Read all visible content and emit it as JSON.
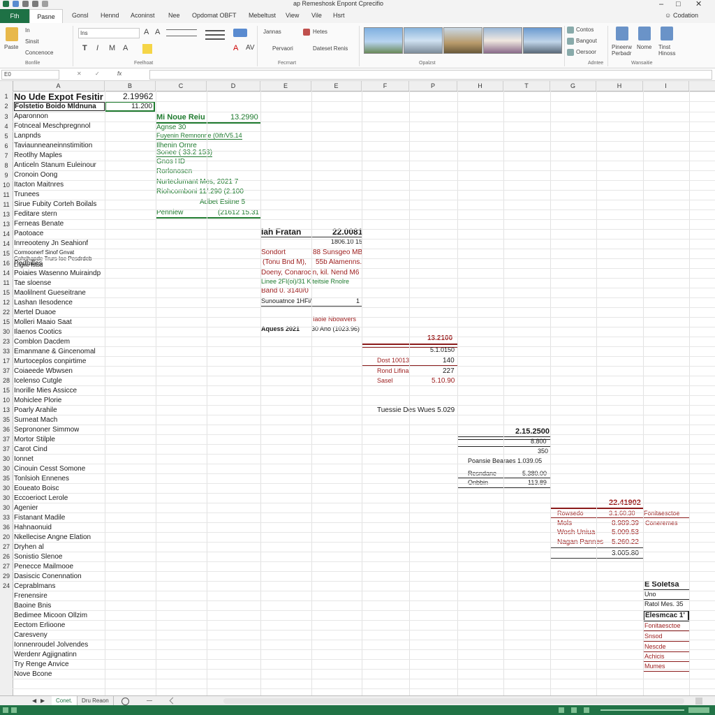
{
  "titlebar": {
    "title": "ap Remeshosk Enpont Cprecifio",
    "min": "–",
    "max": "□",
    "close": "✕"
  },
  "menu": {
    "file": "Fth",
    "home": "Pasne",
    "items": [
      "Gonsl",
      "Hennd",
      "Aconinst",
      "Nee",
      "Opdomat OBFT",
      "Mebeltust",
      "View",
      "Vile",
      "Hsrt"
    ],
    "help": "Codation",
    "user": "☺"
  },
  "ribbon": {
    "clipboard": {
      "paste": "Paste",
      "cut": "In",
      "copy": "Sinsit",
      "format": "Concenoce",
      "name": "Bonfile"
    },
    "font": {
      "name": "Feelhoat",
      "font_value": "Ins",
      "bold": "T",
      "italic": "I",
      "underline": "M",
      "grow": "A",
      "size": "A",
      "fill": "A",
      "border": "AV"
    },
    "alignment": {
      "name": "Fecrnart",
      "items": [
        "Jannas",
        "Hetes",
        "Pervaori",
        "Dateset Renis"
      ]
    },
    "styles": {
      "name": "Opalzst"
    },
    "cells": {
      "name": "Adntee",
      "items": [
        "Contos",
        "Bangout",
        "Oersoor"
      ]
    },
    "editing": {
      "name": "Wansaitie",
      "items": [
        "Pineerw Perbadr",
        "Nome",
        "Tinst Hinoss"
      ]
    }
  },
  "formula_bar": {
    "name_box": "E0",
    "fx": "fx",
    "formula": ""
  },
  "columns": [
    "A",
    "B",
    "C",
    "D",
    "E",
    "E",
    "F",
    "P",
    "H",
    "T",
    "G",
    "H",
    "I"
  ],
  "rows": [
    "1",
    "2",
    "3",
    "4",
    "5",
    "6",
    "7",
    "8",
    "9",
    "10",
    "11",
    "11",
    "13",
    "13",
    "14",
    "14",
    "15",
    "16",
    "14",
    "11",
    "15",
    "12",
    "22",
    "15",
    "30",
    "23",
    "33",
    "17",
    "37",
    "28",
    "15",
    "10",
    "13",
    "35",
    "36",
    "37",
    "37",
    "30",
    "30",
    "35",
    "30",
    "30",
    "30",
    "33",
    "36",
    "20",
    "27",
    "26",
    "27",
    "29",
    "24"
  ],
  "col_a": [
    "No Ude Expot Fesitire",
    "Folstetio Boido Mldnuna",
    "Aparonnon",
    "Fotnceal Meschpregnnol",
    "Lanpnds",
    "Taviaunneaneinnstimition",
    "Reotlhy Maples",
    "Anticeln Stanum Euleinour",
    "Cronoin Oong",
    "Itacton Maitnres",
    "Trunees",
    "Sirue Fubity Corteh Boilals",
    "Feditare stern",
    "Ferneas Benate",
    "Paotoace",
    "Inrreooteny Jn Seahionf",
    "Cormoonerf Sinof Gnvat Cohrihapde Trurs Ioe Pesdrdeb Lngne Istsd",
    "Pedhilies",
    "Poiaies Wasenno Muiraindp",
    "Tae sloense",
    "Maolilnent Gueseitrane",
    "Lashan Ilesodence",
    "Mertel Duaoe",
    "Molleri Maaio Saat",
    "Ilaenos Cootics",
    "Comblon Dacdem",
    "Emanmane & Gincenomal",
    "Murtoceplos conpirtime",
    "Coiaeede Wbwsen",
    "Icelenso Cutgle",
    "Inorille Mies Assicce",
    "Mohiclee Plorie",
    "Poarly Arahile",
    "Surneat Mach",
    "Seprononer Simmow",
    "Mortor Stilple",
    "Carot Cind",
    "Ionnet",
    "Cinouin Cesst Somone",
    "Tonlsioh Ennenes",
    "Eoueato Boisc",
    "Eccoerioct Lerole",
    "Agenier",
    "Fistanant Madile",
    "Hahnaonuid",
    "Nkellecise Angne Elation",
    "Dryhen al",
    "Sonistio Slenoe",
    "Penecce Mailmooe",
    "Dasiscic Conennation",
    "Ceprablmans",
    "Frenensire",
    "Baoine Bnis",
    "Bedimee Micoon Ollzim",
    "Eectom Erlioone",
    "Caresveny",
    "Ionnenroudel Jolvendes",
    "Werdenr Agjignatinn",
    "Try Renge Anvice",
    "Nove Bcone"
  ],
  "block_b": {
    "b1": "2.19962",
    "b2": "11.200"
  },
  "block_c": {
    "title": "Mi Noue Reiu",
    "title_val": "13.2990",
    "lines": [
      "Agnse 30",
      "Fuyenin Remnonne (0ifr/V5.14",
      "Ilhenin Ornre",
      "Sonee ( 33.2 153)",
      "Gnos HD",
      "Rorlonosen",
      "Nurteclumant Mes, 2021 7",
      "Riohcomboni 11/.290 (2.100",
      "Adbet Esitne 5",
      "Penniew",
      "(21612 15.31"
    ]
  },
  "block_e": {
    "title": "Iah Fratan",
    "title_val": "22.0081",
    "sub": "1806.10 15",
    "l1a": "Sondort",
    "l1b": "88 Sunsgeo MB",
    "l2a": "(Tonu Bnd M),",
    "l2b": "55b Alamenns.",
    "l3": "Doeny, Conarocin, kil. Nend M6",
    "l4": "Linee 2FI(oi)/31 Klteitsie Rnolre",
    "l5": "Band 0. 3140/0",
    "l6a": "Sunouatnce 1HFi/",
    "l6b": "1",
    "l7": "Iaole Nbowvers",
    "l8a": "Aquess 2021",
    "l8b": "30 Ano (1023.96)"
  },
  "block_f": {
    "title": "13.2100",
    "sub": "5.1.0150",
    "r1a": "Dost 10013",
    "r1b": "140",
    "r2a": "Rond Lifina",
    "r2b": "227",
    "r3a": "Sasel",
    "r3b": "5.10.90",
    "foot": "Tuessie Des Wues 5.029"
  },
  "block_h": {
    "title": "2.15.2500",
    "sub1": "8.800",
    "sub2": "350",
    "r1": "Poansie Bearaes 1.039.05",
    "r2a": "Resndane",
    "r2b": "5.380.00",
    "r3a": "Onbbin",
    "r3b": "113.89"
  },
  "block_g": {
    "title": "22.41902",
    "r1a": "Rowsedo",
    "r1b": "3.1.60.30",
    "r1c": "Fonitaesctoe",
    "r2a": "Mols",
    "r2b": "8.989.39",
    "r2c": "Coneremes",
    "r3a": "Wosh Uniua",
    "r3b": "5.009.53",
    "r4a": "Nagan Pannes",
    "r4b": "5.260.22",
    "r5b": "3.005.80"
  },
  "block_i": {
    "title": "E Soletsa",
    "r1": "Uno",
    "r2": "Ratol Mes. 35",
    "r3": "Elesmcac 1'",
    "items": [
      "Fonitaesctoe",
      "Snsod",
      "Nescde",
      "Achicis",
      "Mumes"
    ]
  },
  "sheets": [
    "Conet.",
    "Dru Reaon"
  ],
  "sheet_nav": [
    "◀",
    "▶"
  ],
  "status": {
    "zoom": "",
    "ready": ""
  }
}
